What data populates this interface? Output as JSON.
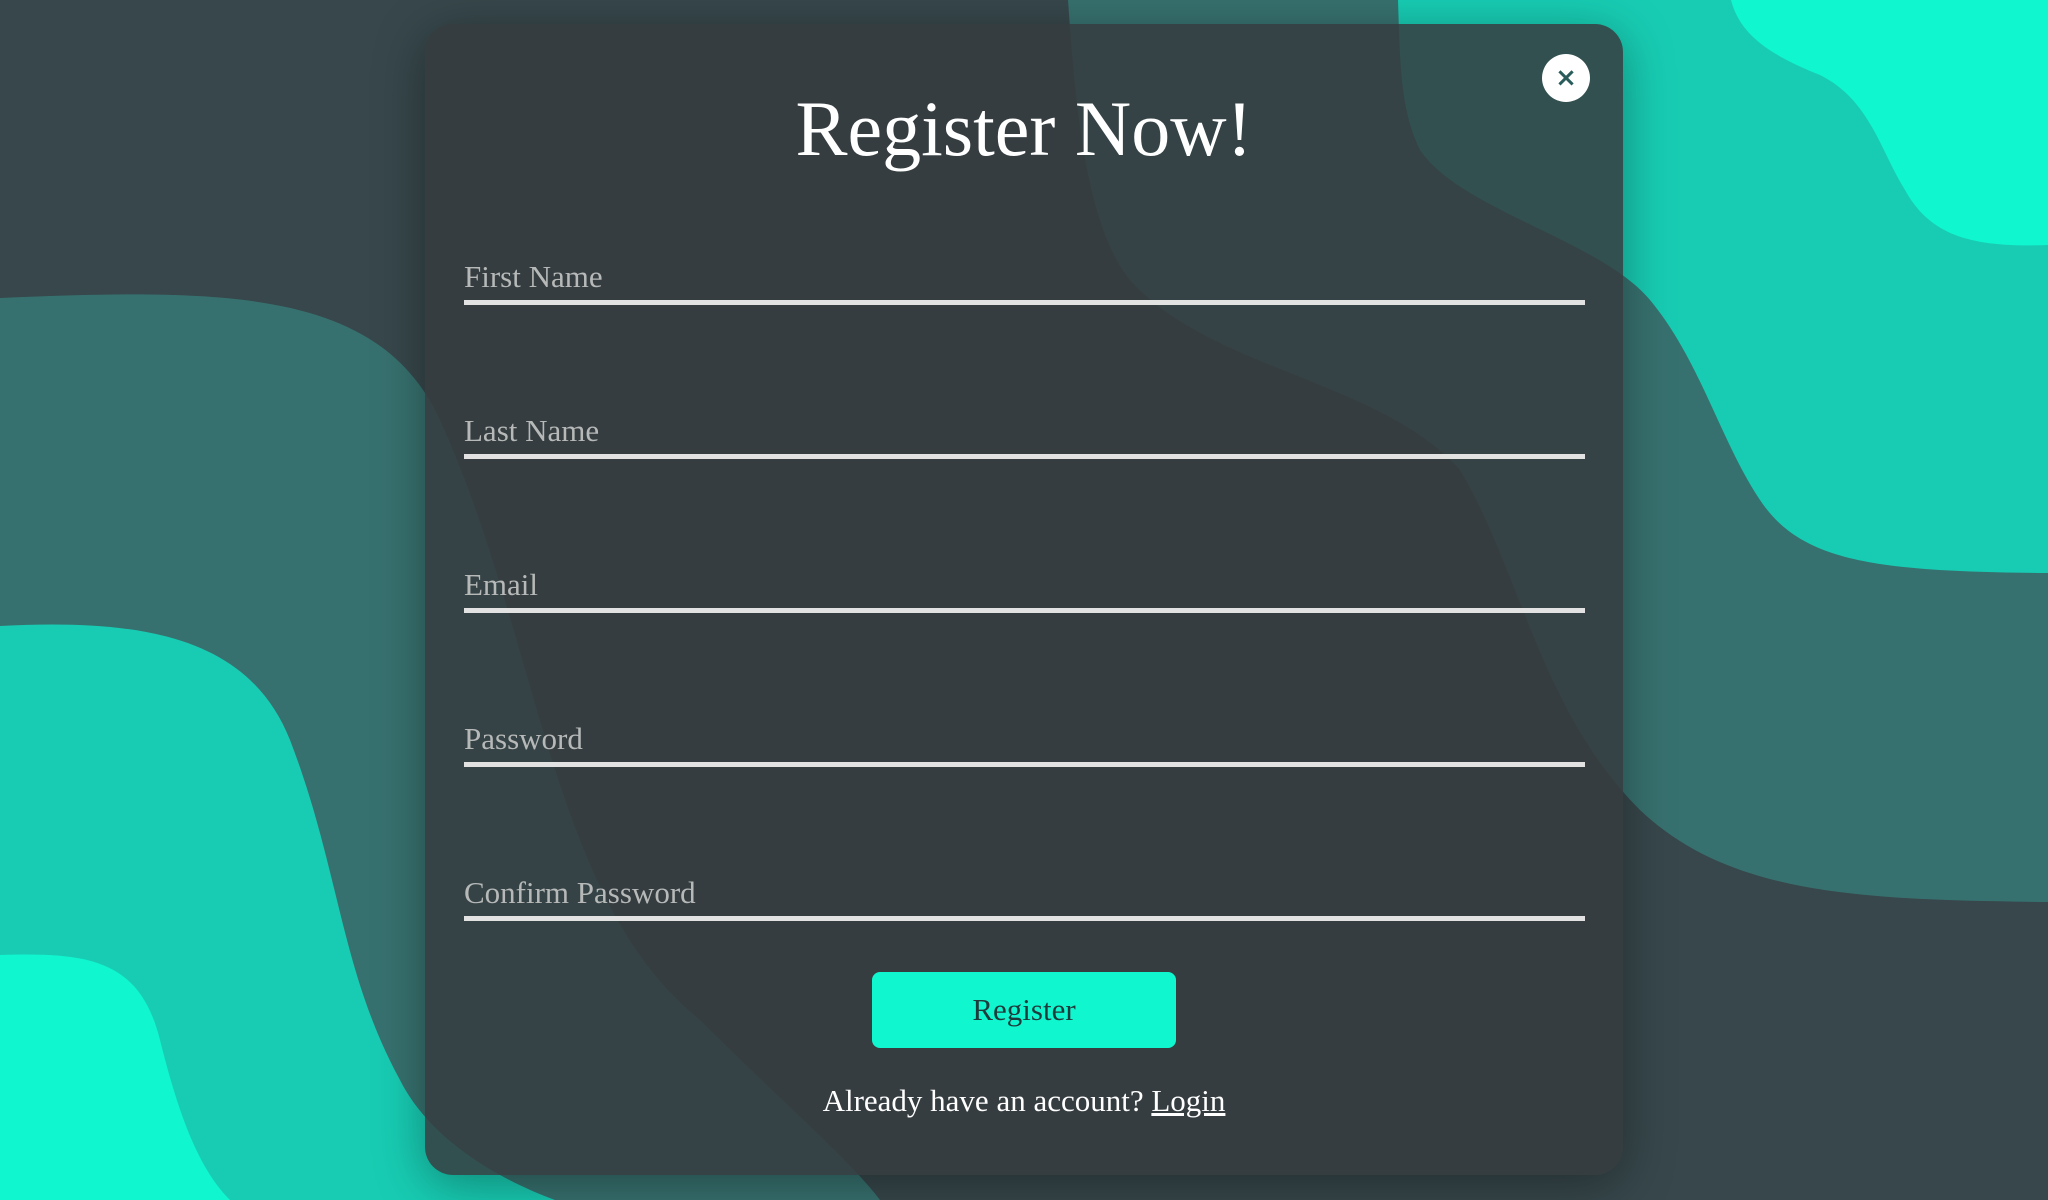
{
  "modal": {
    "title": "Register Now!",
    "close_icon": "×",
    "fields": {
      "first_name": {
        "placeholder": "First Name",
        "value": ""
      },
      "last_name": {
        "placeholder": "Last Name",
        "value": ""
      },
      "email": {
        "placeholder": "Email",
        "value": ""
      },
      "password": {
        "placeholder": "Password",
        "value": ""
      },
      "confirm_password": {
        "placeholder": "Confirm Password",
        "value": ""
      }
    },
    "register_label": "Register",
    "login_prompt": "Already have an account?",
    "login_link": "Login"
  },
  "colors": {
    "background_dark": "#37474b",
    "wave_mid": "#37716f",
    "wave_bright": "#18ccb3",
    "accent": "#10f6cf",
    "panel": "#363b3f"
  },
  "icons": {
    "close": "close-icon"
  }
}
